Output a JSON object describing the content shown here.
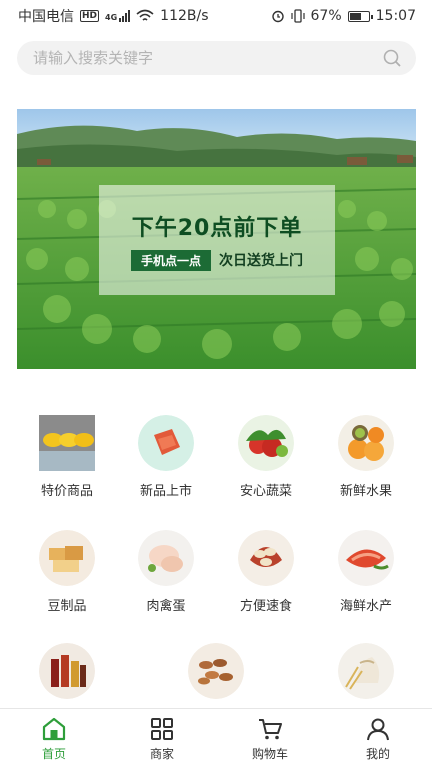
{
  "status_bar": {
    "carrier": "中国电信",
    "hd": "HD",
    "network": "4G",
    "speed": "112B/s",
    "battery": "67%",
    "battery_level": 0.67,
    "time": "15:07"
  },
  "search": {
    "placeholder": "请输入搜索关键字"
  },
  "banner": {
    "title": "下午20点前下单",
    "chip": "手机点一点",
    "subtitle": "次日送货上门"
  },
  "categories": [
    {
      "label": "特价商品",
      "icon": "corn-icon"
    },
    {
      "label": "新品上市",
      "icon": "new-badge-icon"
    },
    {
      "label": "安心蔬菜",
      "icon": "vegetables-icon"
    },
    {
      "label": "新鲜水果",
      "icon": "fruit-icon"
    },
    {
      "label": "豆制品",
      "icon": "tofu-icon"
    },
    {
      "label": "肉禽蛋",
      "icon": "poultry-icon"
    },
    {
      "label": "方便速食",
      "icon": "dumpling-icon"
    },
    {
      "label": "海鲜水产",
      "icon": "shrimp-icon"
    },
    {
      "label": "",
      "icon": "liquor-icon"
    },
    {
      "label": "",
      "icon": "nuts-icon"
    },
    {
      "label": "",
      "icon": "grain-icon"
    }
  ],
  "bottom_nav": {
    "items": [
      {
        "label": "首页",
        "icon": "home-icon",
        "active": true
      },
      {
        "label": "商家",
        "icon": "grid-icon",
        "active": false
      },
      {
        "label": "购物车",
        "icon": "cart-icon",
        "active": false
      },
      {
        "label": "我的",
        "icon": "user-icon",
        "active": false
      }
    ]
  },
  "colors": {
    "accent": "#2e9e3a",
    "banner_text": "#0e4d22",
    "banner_chip": "#1c6b35"
  }
}
